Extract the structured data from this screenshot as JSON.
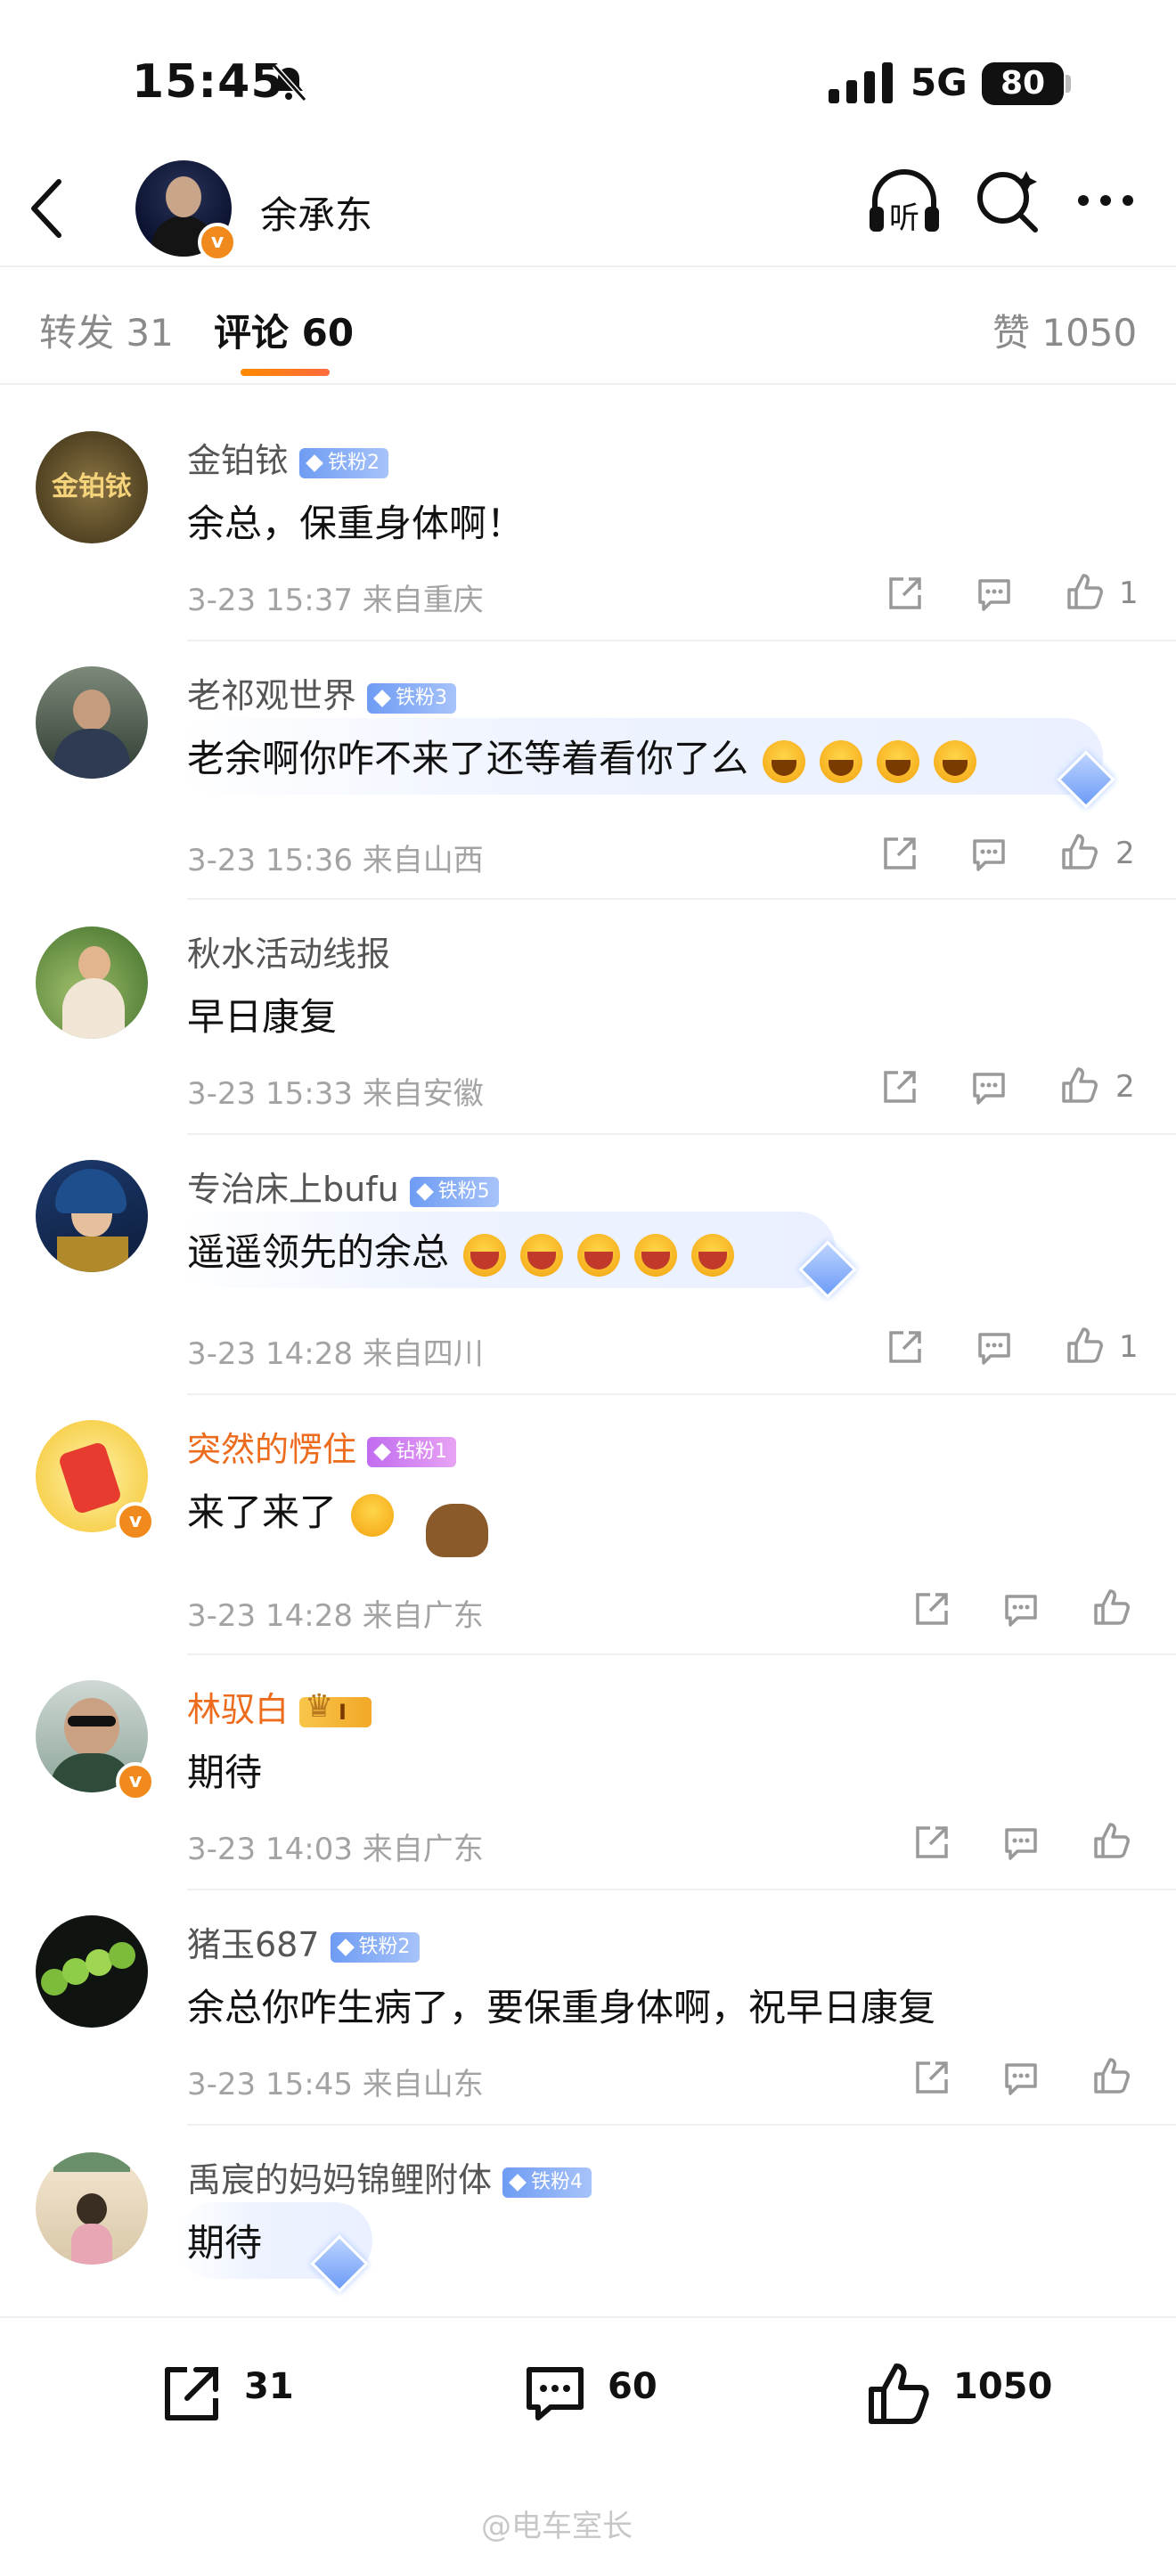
{
  "status_bar": {
    "time": "15:45",
    "network": "5G",
    "battery": "80"
  },
  "header": {
    "title": "余承东"
  },
  "tabs": {
    "repost": "转发 31",
    "comments": "评论 60",
    "likes": "赞 1050"
  },
  "comments": [
    {
      "name": "金铂铱",
      "badge": "铁粉2",
      "text": "余总，保重身体啊！",
      "meta": "3-23 15:37  来自重庆",
      "likes": "1",
      "avatar_color": "#5a4a2a",
      "avatar_text": "金铂铱"
    },
    {
      "name": "老祁观世界",
      "badge": "铁粉3",
      "text": "老余啊你咋不来了还等着看你了么",
      "meta": "3-23 15:36  来自山西",
      "likes": "2"
    },
    {
      "name": "秋水活动线报",
      "text": "早日康复",
      "meta": "3-23 15:33  来自安徽",
      "likes": "2"
    },
    {
      "name": "专治床上bufu",
      "badge": "铁粉5",
      "text": "遥遥领先的余总",
      "meta": "3-23 14:28  来自四川",
      "likes": "1"
    },
    {
      "name": "突然的愣住",
      "badge": "钻粉1",
      "text": "来了来了",
      "meta": "3-23 14:28  来自广东",
      "likes": ""
    },
    {
      "name": "林驭白",
      "badge": "I",
      "text": "期待",
      "meta": "3-23 14:03  来自广东",
      "likes": ""
    },
    {
      "name": "猪玉687",
      "badge": "铁粉2",
      "text": "余总你咋生病了，要保重身体啊，祝早日康复",
      "meta": "3-23 15:45  来自山东",
      "likes": ""
    },
    {
      "name": "禹宸的妈妈锦鲤附体",
      "badge": "铁粉4",
      "text": "期待",
      "meta": "",
      "likes": ""
    }
  ],
  "bottom_bar": {
    "reposts": "31",
    "comments": "60",
    "likes": "1050"
  },
  "watermark": "@电车室长",
  "colors": {
    "accent": "#ff8a00",
    "vip_name": "#ec6b1c",
    "fan_badge": "#6e9cf3"
  }
}
